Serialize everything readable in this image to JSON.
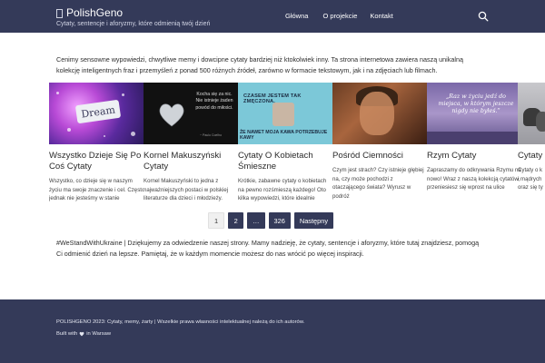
{
  "header": {
    "site_title": "PolishGeno",
    "tagline": "Cytaty, sentencje i aforyzmy, które odmienią twój dzień",
    "nav": [
      {
        "label": "Główna"
      },
      {
        "label": "O projekcie"
      },
      {
        "label": "Kontakt"
      }
    ],
    "search_icon": "search-icon"
  },
  "intro": "Cenimy sensowne wypowiedzi, chwytliwe memy i dowcipne cytaty bardziej niż ktokolwiek inny. Ta strona internetowa zawiera naszą unikalną kolekcję inteligentnych fraz i przemyśleń z ponad 500 różnych źródeł, zarówno w formacie tekstowym, jak i na zdjęciach lub filmach.",
  "cards": [
    {
      "title": "Wszystko Dzieje Się Po Coś Cytaty",
      "excerpt_lines": [
        "Wszystko, co dzieje się w naszym",
        "życiu ma swoje znaczenie i cel. Często",
        "jednak nie jesteśmy w stanie"
      ],
      "image_text": "Dream"
    },
    {
      "title": "Kornel Makuszyński Cytaty",
      "excerpt_lines": [
        "Kornel Makuszyński to jedna z",
        "najważniejszych postaci w polskiej",
        "literaturze dla dzieci i młodzieży."
      ],
      "image_text": "Kocha się za nic. Nie istnieje żaden powód do miłości.",
      "image_author": "~ Paulo Coelho"
    },
    {
      "title": "Cytaty O Kobietach Śmieszne",
      "excerpt_lines": [
        "Krótkie, zabawne cytaty o kobietach",
        "na pewno rozśmieszą każdego! Oto",
        "kilka wypowiedzi, które idealnie"
      ],
      "image_text_top": "CZASEM JESTEM TAK ZMĘCZONA,",
      "image_text_bottom": "ŻE NAWET MOJA KAWA POTRZEBUJE KAWY"
    },
    {
      "title": "Pośród Ciemności",
      "excerpt_lines": [
        "Czym jest strach? Czy istnieje głębiej",
        "na, czy może pochodzi z",
        "otaczającego świata? Wyrusz w",
        "podróż"
      ]
    },
    {
      "title": "Rzym Cytaty",
      "excerpt_lines": [
        "Zapraszamy do odkrywania Rzymu na",
        "nowo! Wraz z naszą kolekcją cytatów,",
        "przeniesiesz się wprost na ulice"
      ],
      "image_text": "„Raz w życiu jedź do miejsca, w którym jeszcze nigdy nie byłeś.”"
    },
    {
      "title": "Cytaty O Ko",
      "excerpt_lines": [
        "Cytaty o k",
        "i mądrych",
        "oraz się ty"
      ]
    }
  ],
  "pagination": {
    "current": "1",
    "pages": [
      "2",
      "…",
      "326"
    ],
    "next_label": "Następny"
  },
  "note": "#WeStandWithUkraine | Dziękujemy za odwiedzenie naszej strony. Mamy nadzieję, że cytaty, sentencje i aforyzmy, które tutaj znajdziesz, pomogą Ci odmienić dzień na lepsze. Pamiętaj, że w każdym momencie możesz do nas wrócić po więcej inspiracji.",
  "footer": {
    "copyright": "POLISHGENO 2023: Cytaty, memy, żarty | Wszelkie prawa własności intelektualnej należą do ich autorów.",
    "built_prefix": "Built with",
    "built_suffix": "in Warsaw"
  },
  "colors": {
    "header_bg": "#343a59",
    "footer_bg": "#343a59",
    "accent": "#343a59"
  }
}
